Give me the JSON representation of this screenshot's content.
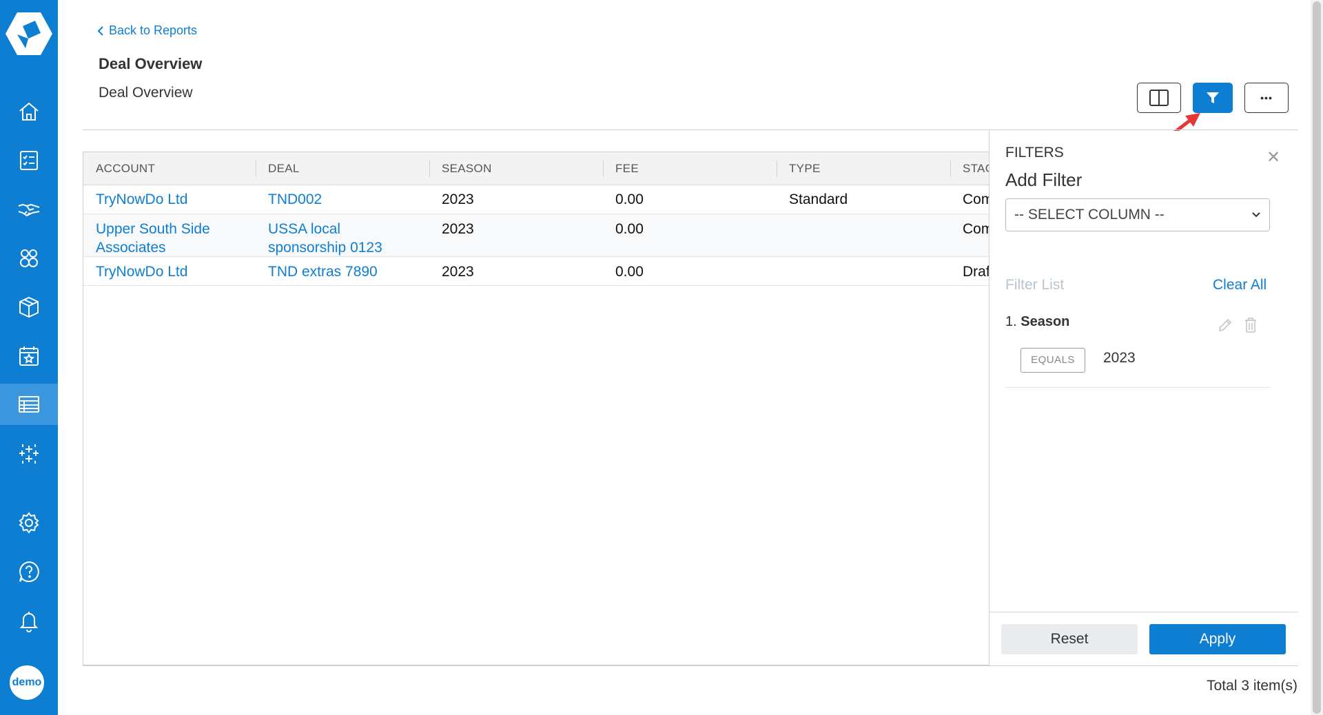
{
  "nav": {
    "logo_icon": "brand-logo-icon",
    "items": [
      {
        "icon": "home-icon"
      },
      {
        "icon": "checklist-icon"
      },
      {
        "icon": "handshake-icon"
      },
      {
        "icon": "groups-icon"
      },
      {
        "icon": "box-icon"
      },
      {
        "icon": "calendar-star-icon"
      },
      {
        "icon": "reports-icon",
        "active": true
      },
      {
        "icon": "sparkles-icon"
      },
      {
        "icon": "gear-icon"
      },
      {
        "icon": "help-icon"
      },
      {
        "icon": "bell-icon"
      }
    ],
    "avatar_label": "demo"
  },
  "header": {
    "back_label": "Back to Reports",
    "title": "Deal Overview",
    "subtitle": "Deal Overview"
  },
  "toolbar": {
    "columns_icon": "columns-icon",
    "filter_icon": "filter-icon",
    "more_icon": "more-icon",
    "more_label": "•••"
  },
  "table": {
    "columns": [
      "ACCOUNT",
      "DEAL",
      "SEASON",
      "FEE",
      "TYPE",
      "STAGE"
    ],
    "rows": [
      {
        "account": "TryNowDo Ltd",
        "deal": "TND002",
        "season": "2023",
        "fee": "0.00",
        "type": "Standard",
        "stage": "Complete"
      },
      {
        "account": "Upper South Side Associates",
        "deal": "USSA local sponsorship 0123",
        "season": "2023",
        "fee": "0.00",
        "type": "",
        "stage": "Complete"
      },
      {
        "account": "TryNowDo Ltd",
        "deal": "TND extras 7890",
        "season": "2023",
        "fee": "0.00",
        "type": "",
        "stage": "Draft"
      }
    ]
  },
  "filters": {
    "heading": "FILTERS",
    "add_filter": "Add Filter",
    "select_placeholder": "-- SELECT COLUMN --",
    "filter_list_label": "Filter List",
    "clear_all": "Clear All",
    "items": [
      {
        "index": "1.",
        "column": "Season",
        "operator": "EQUALS",
        "value": "2023"
      }
    ],
    "reset_label": "Reset",
    "apply_label": "Apply"
  },
  "footer": {
    "total_label": "Total 3 item(s)"
  },
  "colors": {
    "brand": "#0e7ed3",
    "arrow": "#e53935"
  }
}
